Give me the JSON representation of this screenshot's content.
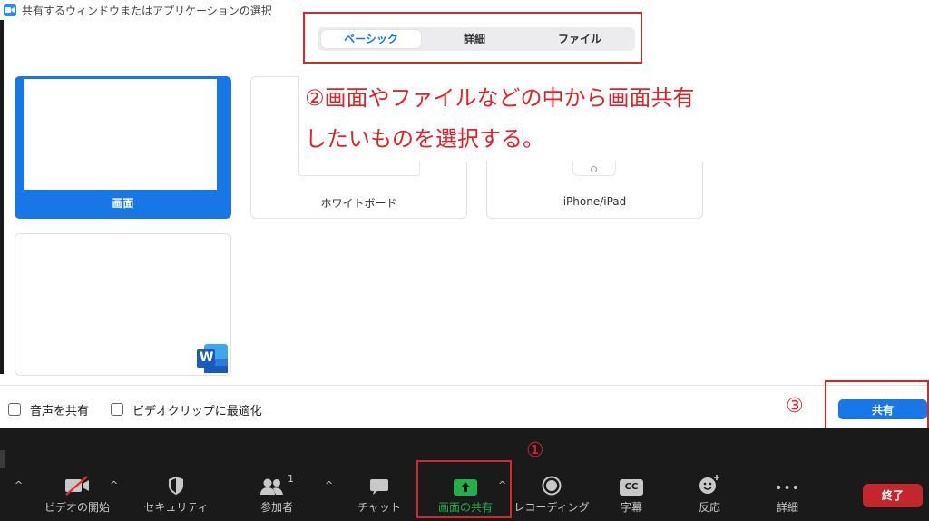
{
  "window": {
    "title": "共有するウィンドウまたはアプリケーションの選択"
  },
  "tabs": [
    {
      "label": "ベーシック",
      "active": true
    },
    {
      "label": "詳細",
      "active": false
    },
    {
      "label": "ファイル",
      "active": false
    }
  ],
  "cards": [
    {
      "label": "画面",
      "selected": true
    },
    {
      "label": "ホワイトボード",
      "selected": false
    },
    {
      "label": "iPhone/iPad",
      "selected": false
    },
    {
      "label": "",
      "selected": false,
      "app_icon": "word-icon",
      "app_icon_letter": "W"
    }
  ],
  "annotation": {
    "line1": "②画面やファイルなどの中から画面共有",
    "line2": "したいものを選択する。",
    "step1": "①",
    "step3": "③"
  },
  "options": {
    "share_audio": {
      "label": "音声を共有",
      "checked": false
    },
    "optimize_video": {
      "label": "ビデオクリップに最適化",
      "checked": false
    }
  },
  "share_button": {
    "label": "共有"
  },
  "toolbar": {
    "items": [
      {
        "label": "ビデオの開始",
        "icon": "video-off-icon"
      },
      {
        "label": "セキュリティ",
        "icon": "shield-icon"
      },
      {
        "label": "参加者",
        "icon": "participants-icon",
        "count": "1"
      },
      {
        "label": "チャット",
        "icon": "chat-icon"
      },
      {
        "label": "画面の共有",
        "icon": "share-screen-icon",
        "active": true
      },
      {
        "label": "レコーディング",
        "icon": "record-icon"
      },
      {
        "label": "字幕",
        "icon": "cc-icon",
        "badge": "CC"
      },
      {
        "label": "反応",
        "icon": "emoji-icon"
      },
      {
        "label": "詳細",
        "icon": "more-icon",
        "glyph": "•••"
      }
    ],
    "end_label": "終了"
  },
  "colors": {
    "accent": "#1877e6",
    "annotation": "#d9262c",
    "share_active": "#22b04a",
    "end": "#c4262e"
  }
}
